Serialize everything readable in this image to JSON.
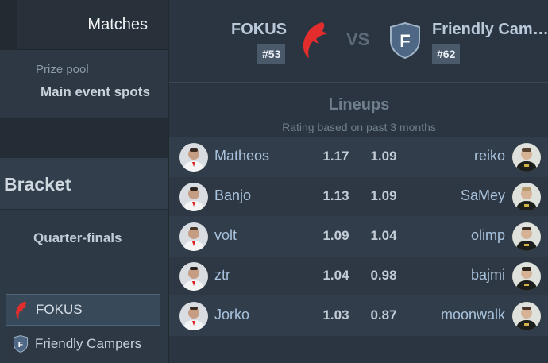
{
  "sidebar": {
    "tab_label": "Matches",
    "prize_pool_label": "Prize pool",
    "main_event_label": "Main event spots",
    "bracket_title": "Bracket",
    "round_title": "Quarter-finals",
    "bracket_teams": [
      {
        "name": "FOKUS",
        "logo": "fokus-logo",
        "selected": true
      },
      {
        "name": "Friendly Campers",
        "logo": "friendly-campers-logo",
        "selected": false
      }
    ]
  },
  "match": {
    "team1": {
      "name": "FOKUS",
      "rank": "#53",
      "logo": "fokus-logo"
    },
    "vs_label": "VS",
    "team2": {
      "name": "Friendly Campers",
      "rank": "#62",
      "logo": "friendly-campers-logo",
      "logo_letter": "F"
    }
  },
  "lineups": {
    "title": "Lineups",
    "subtitle": "Rating based on past 3 months",
    "rows": [
      {
        "left_player": "Matheos",
        "left_rating": "1.17",
        "right_rating": "1.09",
        "right_player": "reiko"
      },
      {
        "left_player": "Banjo",
        "left_rating": "1.13",
        "right_rating": "1.09",
        "right_player": "SaMey"
      },
      {
        "left_player": "volt",
        "left_rating": "1.09",
        "right_rating": "1.04",
        "right_player": "olimp"
      },
      {
        "left_player": "ztr",
        "left_rating": "1.04",
        "right_rating": "0.98",
        "right_player": "bajmi"
      },
      {
        "left_player": "Jorko",
        "left_rating": "1.03",
        "right_rating": "0.87",
        "right_player": "moonwalk"
      }
    ]
  },
  "colors": {
    "background": "#2d3844",
    "accent_red": "#e32d2d",
    "shield_blue": "#4d6784",
    "player_link": "#a9c2dc",
    "rank_badge": "#4a5a6b"
  }
}
